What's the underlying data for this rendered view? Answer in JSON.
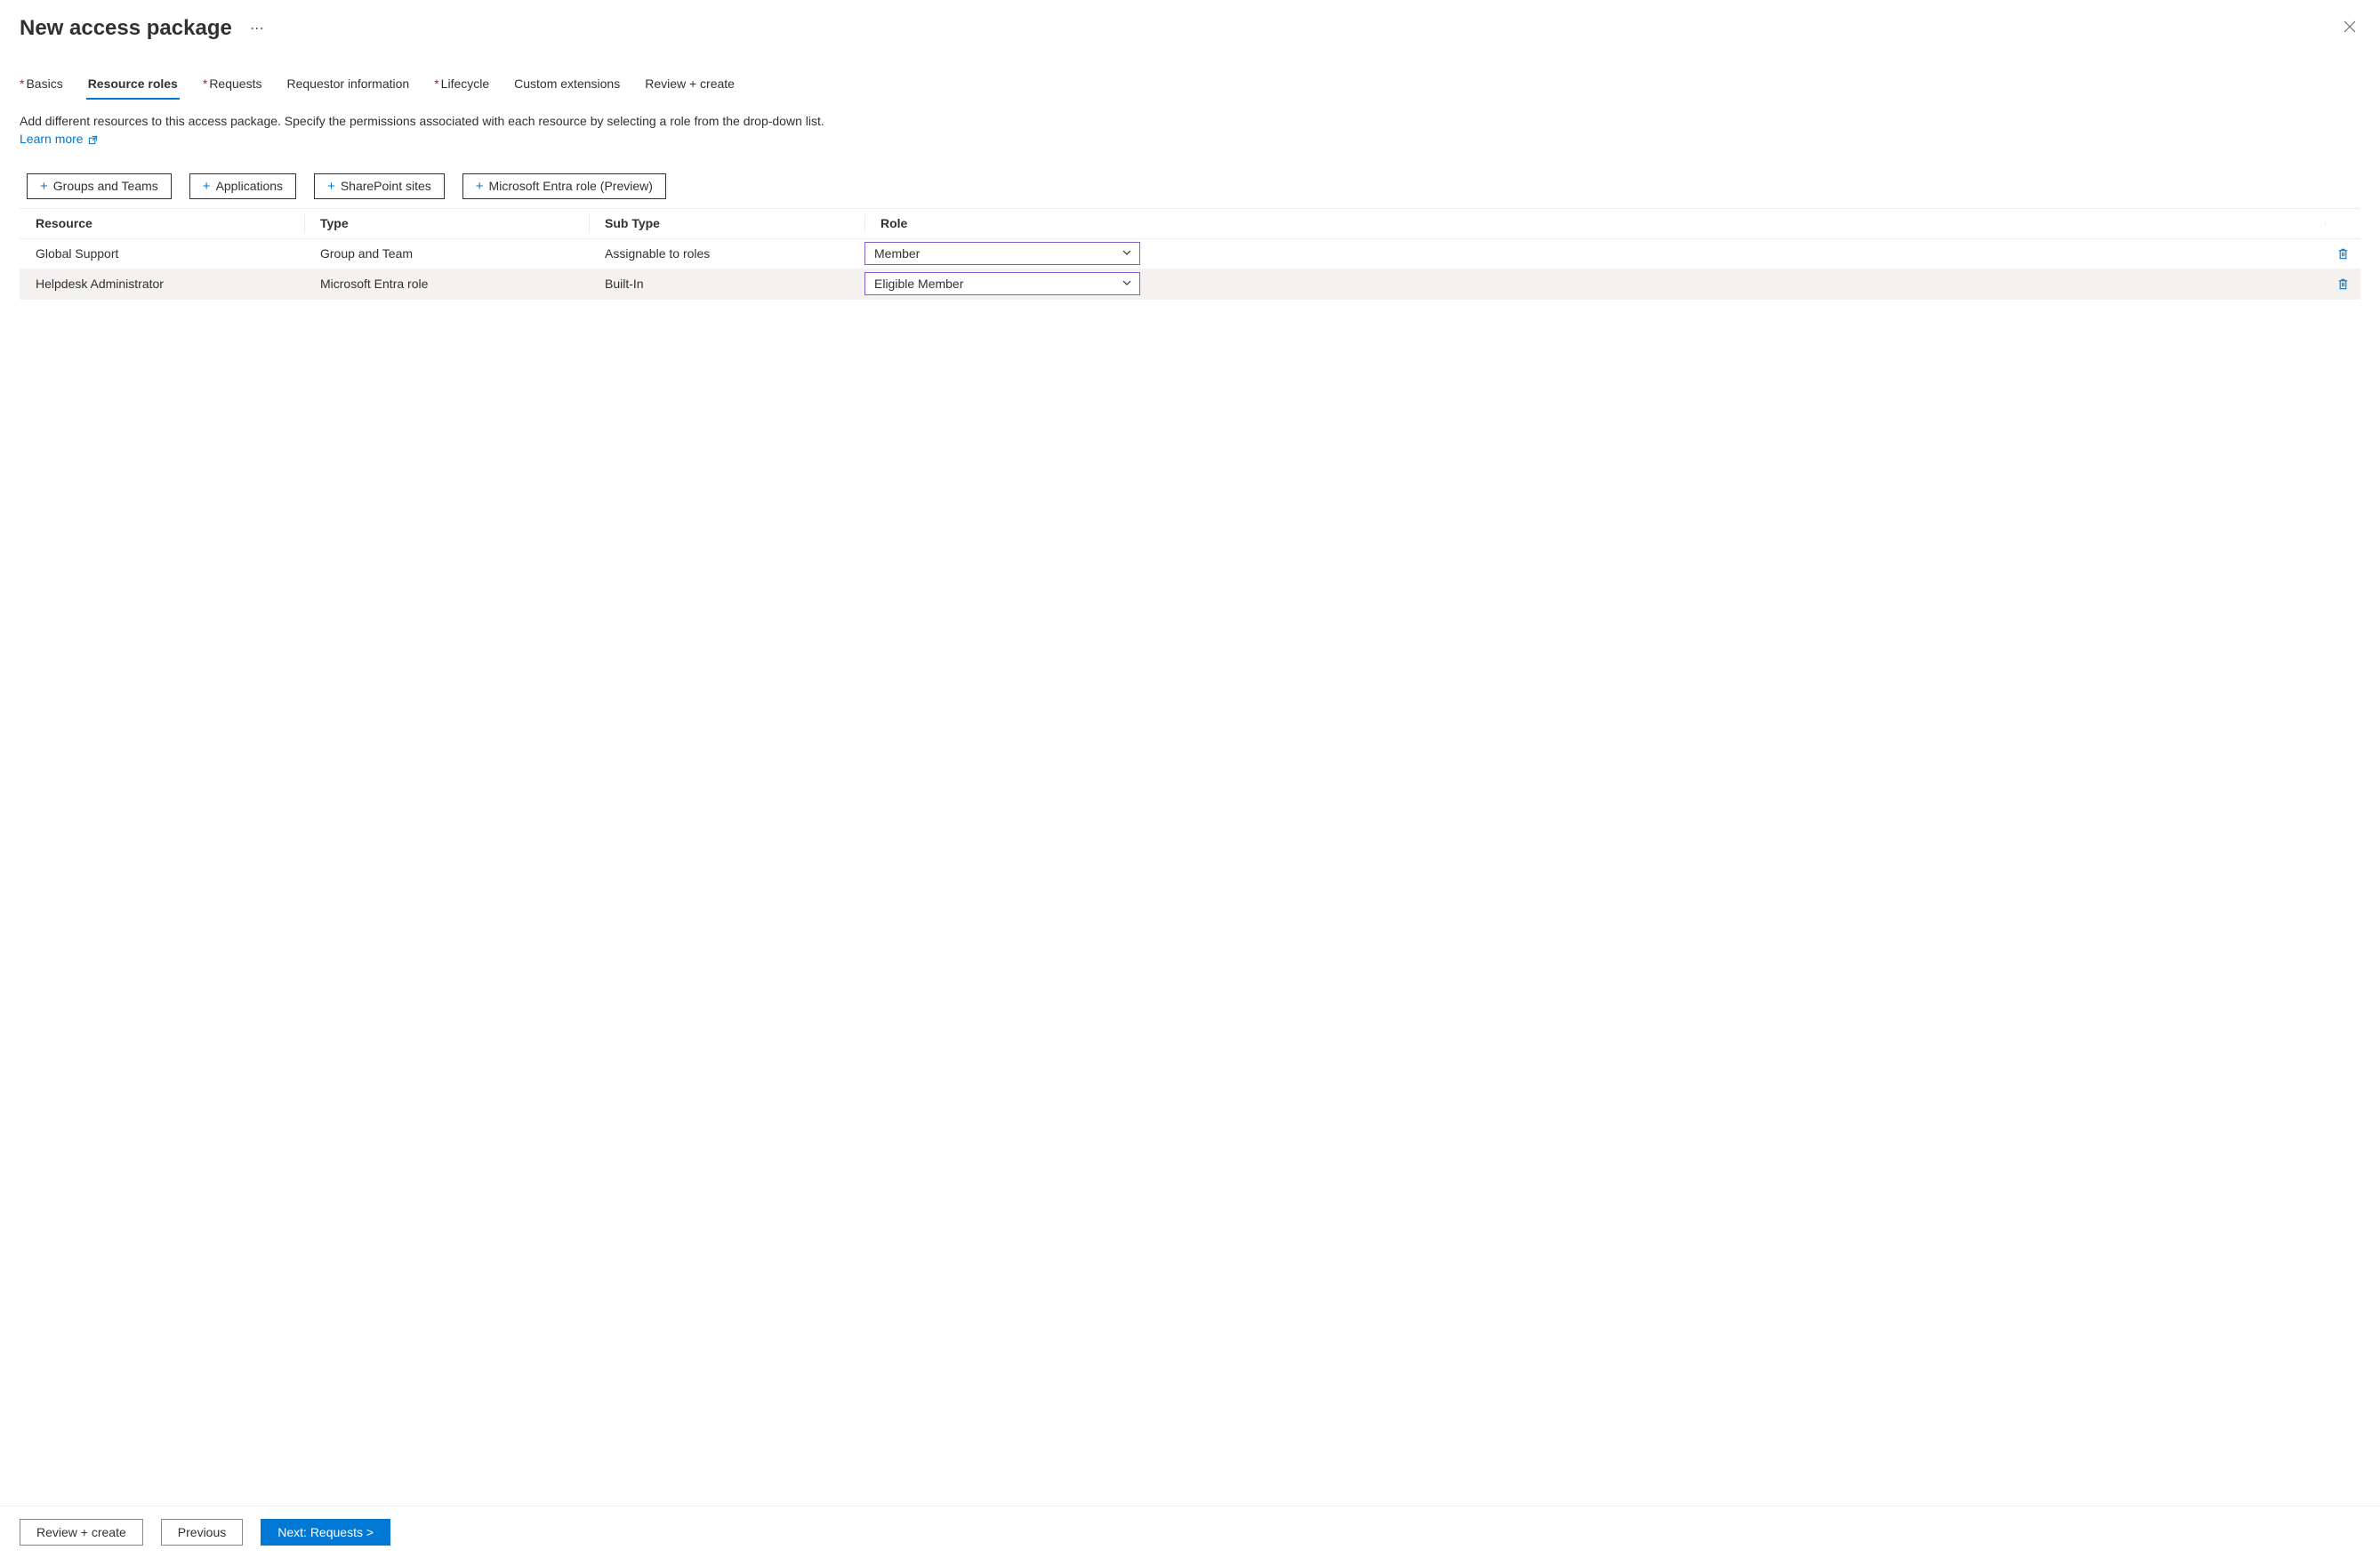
{
  "header": {
    "title": "New access package",
    "more_symbol": "⋯"
  },
  "tabs": [
    {
      "label": "Basics",
      "required": true,
      "active": false
    },
    {
      "label": "Resource roles",
      "required": false,
      "active": true
    },
    {
      "label": "Requests",
      "required": true,
      "active": false
    },
    {
      "label": "Requestor information",
      "required": false,
      "active": false
    },
    {
      "label": "Lifecycle",
      "required": true,
      "active": false
    },
    {
      "label": "Custom extensions",
      "required": false,
      "active": false
    },
    {
      "label": "Review + create",
      "required": false,
      "active": false
    }
  ],
  "description": {
    "text": "Add different resources to this access package. Specify the permissions associated with each resource by selecting a role from the drop-down list. ",
    "link_label": "Learn more"
  },
  "add_buttons": [
    "Groups and Teams",
    "Applications",
    "SharePoint sites",
    "Microsoft Entra role (Preview)"
  ],
  "table": {
    "headers": [
      "Resource",
      "Type",
      "Sub Type",
      "Role"
    ],
    "rows": [
      {
        "resource": "Global Support",
        "type": "Group and Team",
        "subtype": "Assignable to roles",
        "role": "Member",
        "alt": false
      },
      {
        "resource": "Helpdesk Administrator",
        "type": "Microsoft Entra role",
        "subtype": "Built-In",
        "role": "Eligible Member",
        "alt": true
      }
    ]
  },
  "footer": {
    "review": "Review + create",
    "previous": "Previous",
    "next": "Next: Requests >"
  }
}
